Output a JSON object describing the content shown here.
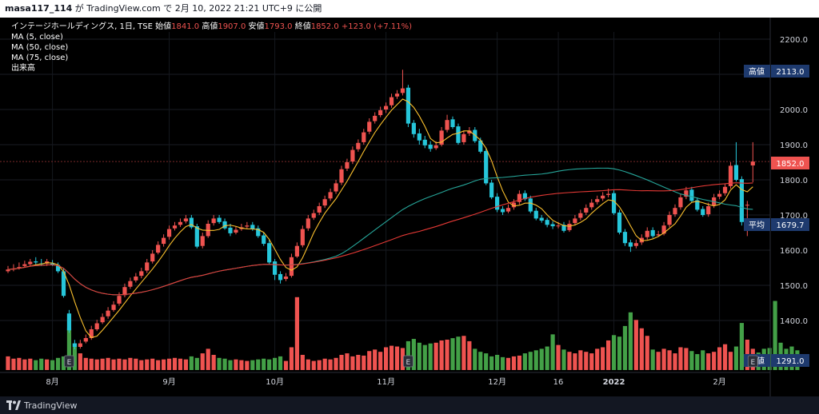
{
  "header": {
    "user": "masa117_114",
    "rest": " が TradingView.com で 2月 10, 2022 21:21 UTC+9 に公開"
  },
  "legend": {
    "title": "インテージホールディングス, 1日, TSE",
    "open_label": "始値",
    "open": "1841.0",
    "high_label": "高値",
    "high": "1907.0",
    "low_label": "安値",
    "low": "1793.0",
    "close_label": "終値",
    "close": "1852.0",
    "change": "+123.0 (+7.11%)",
    "ma5": "MA (5, close)",
    "ma50": "MA (50, close)",
    "ma75": "MA (75, close)",
    "volume": "出来高"
  },
  "footer": {
    "brand": "TradingView"
  },
  "colors": {
    "up": "#ef5350",
    "down": "#26c6da",
    "vol_up": "#ef5350",
    "vol_down": "#43a047",
    "ma5": "#fbc02d",
    "ma50": "#26a69a",
    "ma75": "#e53935",
    "badge": "#1e3a6e"
  },
  "chart_data": {
    "type": "candlestick",
    "y_ticks": [
      1400,
      1500,
      1600,
      1700,
      1800,
      1900,
      2000,
      2100,
      2200
    ],
    "y_tick_labels": [
      "1400.0",
      "1500.0",
      "1600.0",
      "1700.0",
      "1800.0",
      "1900.0",
      "2000.0",
      "2100.0",
      "2200.0"
    ],
    "x_labels": [
      "8月",
      "9月",
      "10月",
      "11月",
      "12月",
      "16",
      "2022",
      "2月"
    ],
    "x_label_index": [
      8,
      29,
      48,
      68,
      88,
      99,
      109,
      128
    ],
    "earnings_markers": [
      "E",
      "E",
      "E"
    ],
    "earnings_index": [
      11,
      72,
      134
    ],
    "price_badges": [
      {
        "label": "高値",
        "value": "2113.0"
      },
      {
        "label": "",
        "value": "1852.0"
      },
      {
        "label": "平均",
        "value": "1679.7"
      },
      {
        "label": "安値",
        "value": "1291.0"
      }
    ],
    "closes": [
      1545,
      1548,
      1552,
      1560,
      1567,
      1565,
      1560,
      1568,
      1558,
      1540,
      1470,
      1372,
      1325,
      1335,
      1350,
      1375,
      1392,
      1410,
      1428,
      1445,
      1470,
      1495,
      1512,
      1525,
      1540,
      1565,
      1590,
      1615,
      1635,
      1660,
      1670,
      1680,
      1690,
      1665,
      1610,
      1640,
      1675,
      1690,
      1680,
      1662,
      1648,
      1658,
      1665,
      1670,
      1660,
      1640,
      1618,
      1565,
      1530,
      1515,
      1525,
      1580,
      1612,
      1660,
      1690,
      1705,
      1725,
      1745,
      1765,
      1790,
      1830,
      1850,
      1885,
      1905,
      1935,
      1965,
      1982,
      1998,
      2010,
      2035,
      2045,
      2060,
      1960,
      1930,
      1912,
      1898,
      1888,
      1898,
      1940,
      1970,
      1950,
      1905,
      1930,
      1940,
      1910,
      1880,
      1790,
      1750,
      1715,
      1708,
      1720,
      1735,
      1760,
      1745,
      1710,
      1690,
      1684,
      1672,
      1668,
      1670,
      1655,
      1675,
      1690,
      1705,
      1720,
      1735,
      1745,
      1755,
      1760,
      1705,
      1650,
      1620,
      1610,
      1620,
      1635,
      1655,
      1640,
      1645,
      1670,
      1700,
      1720,
      1750,
      1770,
      1740,
      1715,
      1700,
      1725,
      1750,
      1760,
      1780,
      1840,
      1800,
      1680,
      1729,
      1852
    ],
    "opens": [
      1540,
      1545,
      1550,
      1555,
      1560,
      1568,
      1562,
      1562,
      1562,
      1558,
      1540,
      1420,
      1335,
      1325,
      1340,
      1350,
      1375,
      1395,
      1412,
      1430,
      1448,
      1472,
      1496,
      1514,
      1527,
      1542,
      1568,
      1593,
      1618,
      1638,
      1662,
      1672,
      1682,
      1692,
      1668,
      1612,
      1640,
      1677,
      1692,
      1682,
      1664,
      1650,
      1660,
      1667,
      1672,
      1662,
      1642,
      1620,
      1568,
      1532,
      1518,
      1527,
      1582,
      1614,
      1662,
      1692,
      1707,
      1727,
      1747,
      1767,
      1792,
      1832,
      1852,
      1887,
      1907,
      1937,
      1967,
      1984,
      2000,
      2012,
      2037,
      2047,
      2062,
      1962,
      1932,
      1914,
      1900,
      1890,
      1900,
      1942,
      1972,
      1952,
      1907,
      1932,
      1942,
      1912,
      1882,
      1792,
      1752,
      1717,
      1710,
      1722,
      1737,
      1762,
      1747,
      1712,
      1692,
      1686,
      1674,
      1670,
      1672,
      1657,
      1677,
      1692,
      1707,
      1722,
      1737,
      1747,
      1757,
      1762,
      1707,
      1652,
      1622,
      1612,
      1622,
      1637,
      1657,
      1642,
      1647,
      1672,
      1702,
      1722,
      1752,
      1772,
      1742,
      1717,
      1702,
      1727,
      1752,
      1762,
      1782,
      1842,
      1802,
      1729,
      1841
    ],
    "highs": [
      1555,
      1560,
      1565,
      1570,
      1575,
      1580,
      1575,
      1575,
      1572,
      1565,
      1550,
      1430,
      1345,
      1345,
      1360,
      1385,
      1402,
      1420,
      1438,
      1455,
      1480,
      1505,
      1522,
      1535,
      1550,
      1575,
      1600,
      1625,
      1645,
      1670,
      1680,
      1690,
      1700,
      1700,
      1675,
      1650,
      1685,
      1700,
      1700,
      1690,
      1675,
      1668,
      1675,
      1680,
      1680,
      1670,
      1650,
      1630,
      1575,
      1540,
      1535,
      1590,
      1622,
      1670,
      1700,
      1715,
      1735,
      1755,
      1775,
      1800,
      1840,
      1860,
      1895,
      1915,
      1945,
      1975,
      1992,
      2008,
      2020,
      2045,
      2055,
      2113,
      2070,
      1970,
      1945,
      1925,
      1910,
      1910,
      1950,
      1985,
      1980,
      1960,
      1940,
      1950,
      1950,
      1920,
      1890,
      1800,
      1762,
      1725,
      1730,
      1745,
      1770,
      1770,
      1755,
      1720,
      1700,
      1692,
      1682,
      1680,
      1680,
      1685,
      1700,
      1715,
      1730,
      1745,
      1755,
      1765,
      1775,
      1770,
      1715,
      1660,
      1630,
      1630,
      1645,
      1665,
      1665,
      1655,
      1680,
      1710,
      1730,
      1760,
      1780,
      1780,
      1750,
      1725,
      1735,
      1760,
      1770,
      1790,
      1850,
      1907,
      1810,
      1740,
      1907
    ],
    "lows": [
      1535,
      1540,
      1545,
      1550,
      1555,
      1558,
      1555,
      1555,
      1555,
      1535,
      1465,
      1365,
      1318,
      1320,
      1335,
      1345,
      1370,
      1390,
      1405,
      1425,
      1442,
      1466,
      1490,
      1508,
      1520,
      1535,
      1562,
      1588,
      1610,
      1630,
      1656,
      1666,
      1676,
      1660,
      1605,
      1605,
      1635,
      1670,
      1675,
      1658,
      1640,
      1645,
      1655,
      1660,
      1655,
      1635,
      1612,
      1560,
      1515,
      1505,
      1512,
      1522,
      1578,
      1608,
      1655,
      1686,
      1700,
      1720,
      1740,
      1760,
      1785,
      1825,
      1845,
      1880,
      1900,
      1930,
      1960,
      1978,
      1990,
      2005,
      2030,
      2040,
      1950,
      1920,
      1900,
      1890,
      1880,
      1885,
      1895,
      1935,
      1945,
      1900,
      1900,
      1925,
      1905,
      1875,
      1785,
      1745,
      1708,
      1700,
      1705,
      1715,
      1730,
      1740,
      1705,
      1685,
      1678,
      1665,
      1660,
      1662,
      1650,
      1652,
      1670,
      1685,
      1700,
      1715,
      1730,
      1740,
      1750,
      1700,
      1645,
      1612,
      1595,
      1605,
      1615,
      1630,
      1635,
      1638,
      1642,
      1665,
      1695,
      1715,
      1745,
      1735,
      1710,
      1695,
      1695,
      1720,
      1745,
      1755,
      1775,
      1795,
      1670,
      1640,
      1793
    ],
    "volumes": [
      0.18,
      0.15,
      0.16,
      0.14,
      0.15,
      0.13,
      0.15,
      0.14,
      0.13,
      0.16,
      0.18,
      0.55,
      0.35,
      0.22,
      0.16,
      0.15,
      0.14,
      0.15,
      0.16,
      0.14,
      0.15,
      0.14,
      0.16,
      0.15,
      0.13,
      0.14,
      0.15,
      0.13,
      0.14,
      0.15,
      0.16,
      0.15,
      0.14,
      0.18,
      0.16,
      0.22,
      0.28,
      0.2,
      0.16,
      0.15,
      0.13,
      0.14,
      0.13,
      0.12,
      0.13,
      0.14,
      0.15,
      0.14,
      0.16,
      0.18,
      0.12,
      0.3,
      0.96,
      0.2,
      0.14,
      0.12,
      0.13,
      0.15,
      0.14,
      0.16,
      0.2,
      0.22,
      0.18,
      0.2,
      0.19,
      0.25,
      0.27,
      0.24,
      0.3,
      0.32,
      0.31,
      0.29,
      0.38,
      0.41,
      0.36,
      0.33,
      0.35,
      0.36,
      0.39,
      0.4,
      0.42,
      0.44,
      0.45,
      0.38,
      0.28,
      0.24,
      0.22,
      0.18,
      0.2,
      0.17,
      0.16,
      0.18,
      0.19,
      0.22,
      0.24,
      0.26,
      0.28,
      0.31,
      0.47,
      0.33,
      0.27,
      0.24,
      0.22,
      0.26,
      0.24,
      0.22,
      0.28,
      0.3,
      0.39,
      0.46,
      0.44,
      0.58,
      0.76,
      0.66,
      0.55,
      0.45,
      0.27,
      0.24,
      0.28,
      0.26,
      0.22,
      0.3,
      0.29,
      0.25,
      0.21,
      0.26,
      0.22,
      0.24,
      0.3,
      0.34,
      0.24,
      0.31,
      0.62,
      0.4,
      0.28,
      0.23,
      0.28,
      0.29,
      0.91,
      0.36,
      0.28,
      0.31,
      0.26
    ]
  }
}
